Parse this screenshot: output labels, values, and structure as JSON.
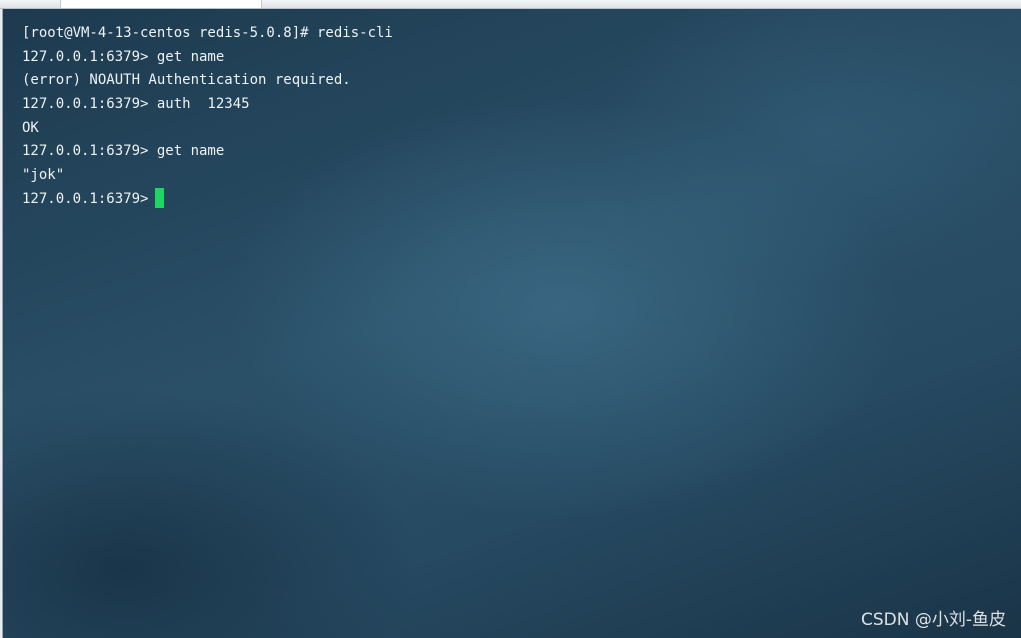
{
  "terminal": {
    "lines": [
      "[root@VM-4-13-centos redis-5.0.8]# redis-cli",
      "127.0.0.1:6379> get name",
      "(error) NOAUTH Authentication required.",
      "127.0.0.1:6379> auth  12345",
      "OK",
      "127.0.0.1:6379> get name",
      "\"jok\"",
      "127.0.0.1:6379>"
    ],
    "cursor_color": "#1ed760",
    "text_color": "#eef2f4"
  },
  "watermark": {
    "text": "CSDN @小刘-鱼皮"
  }
}
